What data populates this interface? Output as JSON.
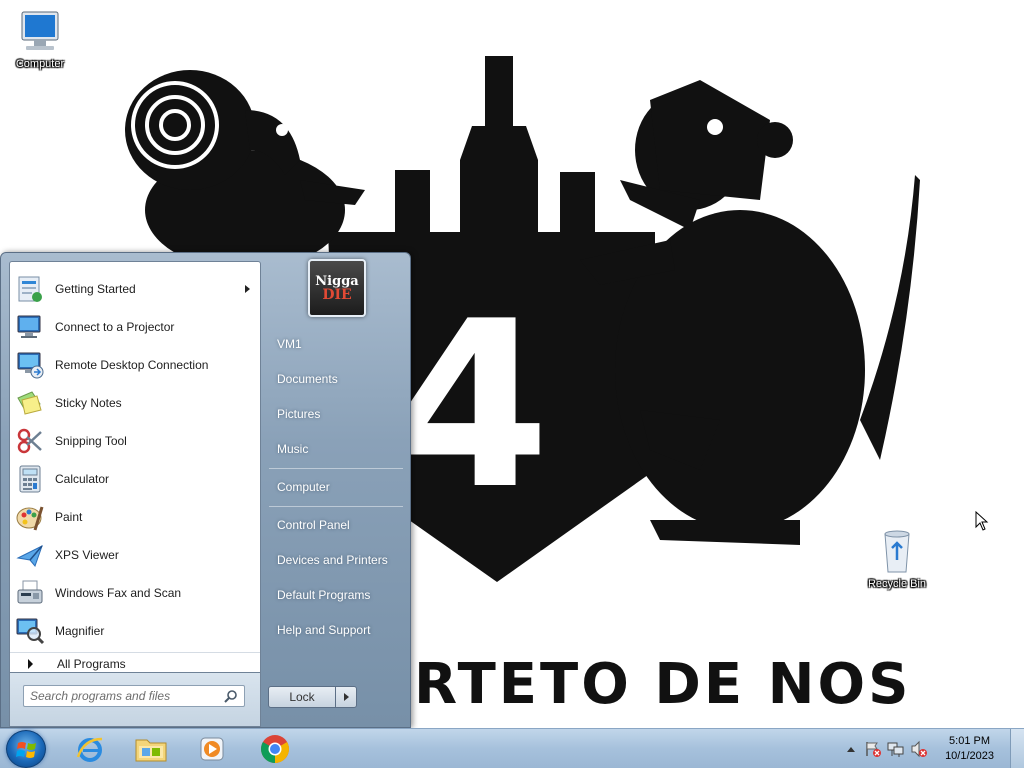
{
  "wallpaper": {
    "text": "RTETO DE NOS",
    "number": "4"
  },
  "desktop": {
    "icons": [
      {
        "label": "Computer",
        "icon": "computer-icon"
      },
      {
        "label": "Recycle Bin",
        "icon": "recycle-bin-icon"
      }
    ]
  },
  "start_menu": {
    "programs": [
      {
        "label": "Getting Started",
        "icon": "getting-started-icon",
        "has_submenu": true
      },
      {
        "label": "Connect to a Projector",
        "icon": "projector-icon"
      },
      {
        "label": "Remote Desktop Connection",
        "icon": "remote-desktop-icon"
      },
      {
        "label": "Sticky Notes",
        "icon": "sticky-notes-icon"
      },
      {
        "label": "Snipping Tool",
        "icon": "snipping-tool-icon"
      },
      {
        "label": "Calculator",
        "icon": "calculator-icon"
      },
      {
        "label": "Paint",
        "icon": "paint-icon"
      },
      {
        "label": "XPS Viewer",
        "icon": "xps-viewer-icon"
      },
      {
        "label": "Windows Fax and Scan",
        "icon": "fax-scan-icon"
      },
      {
        "label": "Magnifier",
        "icon": "magnifier-icon"
      }
    ],
    "all_programs": "All Programs",
    "search_placeholder": "Search programs and files",
    "user_picture": {
      "line1": "Nigga",
      "line2": "DIE"
    },
    "right_links": [
      "VM1",
      "Documents",
      "Pictures",
      "Music",
      "Computer",
      "Control Panel",
      "Devices and Printers",
      "Default Programs",
      "Help and Support"
    ],
    "lock_label": "Lock"
  },
  "taskbar": {
    "pinned": [
      {
        "name": "internet-explorer-icon"
      },
      {
        "name": "windows-explorer-icon"
      },
      {
        "name": "media-player-icon"
      },
      {
        "name": "chrome-icon"
      }
    ],
    "clock": {
      "time": "5:01 PM",
      "date": "10/1/2023"
    }
  }
}
